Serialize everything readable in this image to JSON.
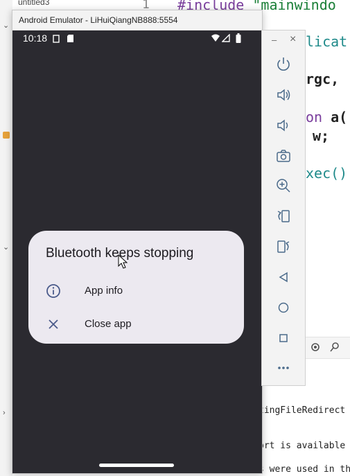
{
  "ide": {
    "project_name": "untitled3",
    "line_number": "1",
    "code_include_kw": "#include",
    "code_include_str": "\"mainwindo",
    "code_line2": "licat",
    "code_line3_a": "rgc,",
    "code_line4_kw": "on",
    "code_line4_b": "a(",
    "code_line5": "w;",
    "code_line6": "xec()",
    "output_line1": "tingFileRedirect",
    "output_line2": "ort is available",
    "output_line3": "s were used in th"
  },
  "emulator": {
    "window_title": "Android Emulator - LiHuiQiangNB888:5554",
    "status": {
      "time": "10:18"
    },
    "dialog": {
      "title": "Bluetooth keeps stopping",
      "options": [
        {
          "label": "App info",
          "icon": "info-icon"
        },
        {
          "label": "Close app",
          "icon": "close-icon"
        }
      ]
    }
  },
  "toolbar": {
    "minimize_label": "–",
    "close_label": "×",
    "buttons": [
      "power-icon",
      "volume-up-icon",
      "volume-down-icon",
      "camera-icon",
      "zoom-icon",
      "rotate-left-icon",
      "rotate-right-icon",
      "back-icon",
      "home-icon",
      "overview-icon",
      "more-icon"
    ]
  }
}
